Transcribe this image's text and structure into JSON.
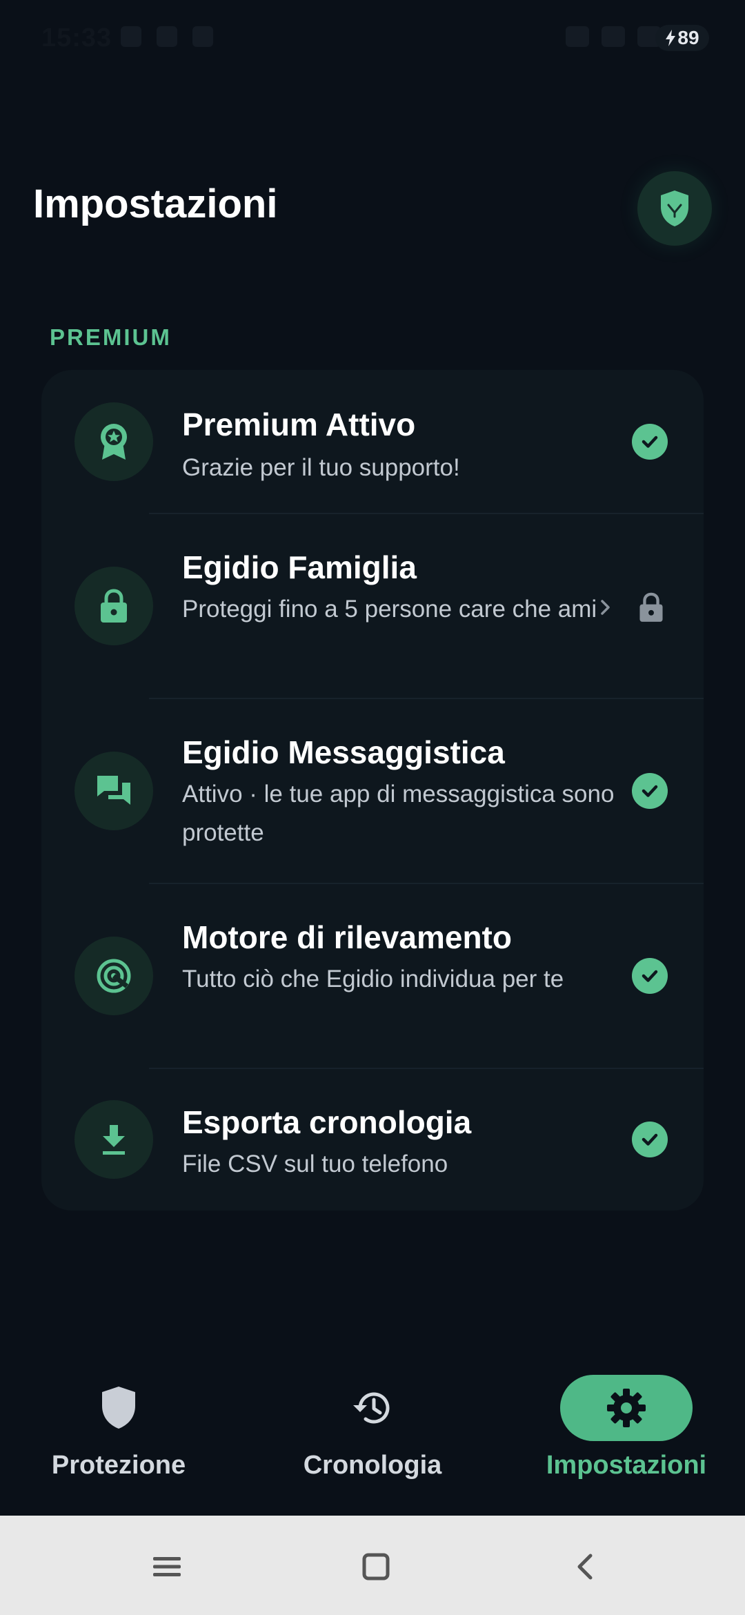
{
  "status_bar": {
    "time": "15:33",
    "battery": "89"
  },
  "header": {
    "title": "Impostazioni",
    "shield_icon": "shield-icon"
  },
  "section": {
    "label": "PREMIUM"
  },
  "rows": [
    {
      "title": "Premium Attivo",
      "subtitle": "Grazie per il tuo supporto!",
      "icon": "award-badge-icon",
      "status": "check"
    },
    {
      "title": "Egidio Famiglia",
      "subtitle": "Proteggi fino a 5 persone care che ami",
      "icon": "lock-icon",
      "status": "locked"
    },
    {
      "title": "Egidio Messaggistica",
      "subtitle": "Attivo · le tue app di messaggistica sono protette",
      "icon": "chat-bubbles-icon",
      "status": "check"
    },
    {
      "title": "Motore di rilevamento",
      "subtitle": "Tutto ciò che Egidio individua per te",
      "icon": "radar-target-icon",
      "status": "check"
    },
    {
      "title": "Esporta cronologia",
      "subtitle": "File CSV sul tuo telefono",
      "icon": "download-icon",
      "status": "check"
    }
  ],
  "bottom_nav": {
    "items": [
      {
        "label": "Protezione",
        "icon": "shield-icon"
      },
      {
        "label": "Cronologia",
        "icon": "history-icon"
      },
      {
        "label": "Impostazioni",
        "icon": "gear-icon"
      }
    ],
    "active": "Impostazioni"
  },
  "colors": {
    "background": "#0a1018",
    "card": "#0e171e",
    "accent": "#5cc391",
    "icon_circle": "#152a26"
  }
}
